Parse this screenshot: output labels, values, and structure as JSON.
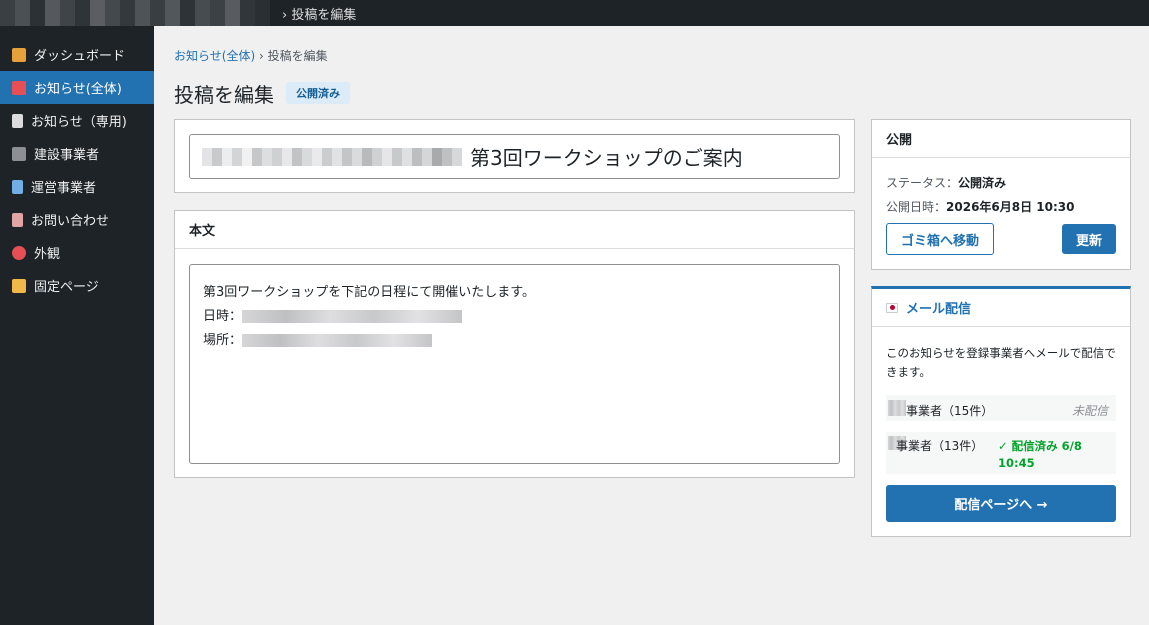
{
  "topbar": {
    "crumb": "› 投稿を編集"
  },
  "sidebar": {
    "items": [
      {
        "label": "ダッシュボード",
        "icon": "home-icon",
        "color": "#d63638"
      },
      {
        "label": "お知らせ(全体)",
        "icon": "megaphone-icon",
        "color": "#e65054"
      },
      {
        "label": "お知らせ（専用)",
        "icon": "document-icon",
        "color": "#c3c4c7"
      },
      {
        "label": "建設事業者",
        "icon": "construction-icon",
        "color": "#8c8f94"
      },
      {
        "label": "運営事業者",
        "icon": "building-icon",
        "color": "#72aee6"
      },
      {
        "label": "お問い合わせ",
        "icon": "clipboard-icon",
        "color": "#d63638"
      },
      {
        "label": "外観",
        "icon": "palette-icon",
        "color": "#e65054"
      },
      {
        "label": "固定ページ",
        "icon": "folder-icon",
        "color": "#f0b849"
      }
    ]
  },
  "breadcrumb": {
    "link": "お知らせ(全体)",
    "sep": " › ",
    "current": "投稿を編集"
  },
  "page": {
    "title": "投稿を編集",
    "status_badge": "公開済み"
  },
  "post": {
    "title_suffix": "第3回ワークショップのご案内"
  },
  "body": {
    "heading": "本文",
    "line1": "第3回ワークショップを下記の日程にて開催いたします。",
    "date_label": "日時：",
    "place_label": "場所："
  },
  "publish": {
    "heading": "公開",
    "status_label": "ステータス：",
    "status_value": "公開済み",
    "date_label": "公開日時：",
    "date_value": "2026年6月8日 10:30",
    "trash_button": "ゴミ箱へ移動",
    "update_button": "更新"
  },
  "mail": {
    "heading": "メール配信",
    "description": "このお知らせを登録事業者へメールで配信できます。",
    "rows": [
      {
        "label": "事業者（15件）",
        "state": "未配信"
      },
      {
        "label": "事業者（13件）",
        "state": "✓ 配信済み 6/8 10:45"
      }
    ],
    "send_button": "配信ページへ →"
  },
  "colors": {
    "accent": "#2271b1",
    "sidebar_bg": "#1d2327",
    "success": "#00a32a"
  }
}
